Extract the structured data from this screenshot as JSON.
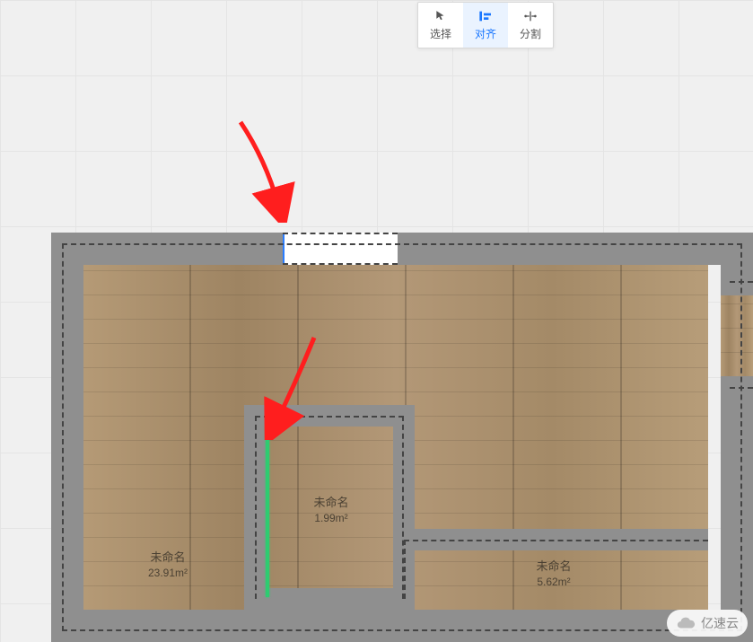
{
  "toolbar": {
    "select": {
      "label": "选择",
      "active": false
    },
    "align": {
      "label": "对齐",
      "active": true
    },
    "split": {
      "label": "分割",
      "active": false
    }
  },
  "rooms": {
    "r1": {
      "name": "未命名",
      "area": "23.91m²"
    },
    "r2": {
      "name": "未命名",
      "area": "1.99m²"
    },
    "r3": {
      "name": "未命名",
      "area": "5.62m²"
    }
  },
  "highlight": {
    "color": "#2ecc71"
  },
  "opening": {
    "edge_color": "#2a7dff"
  },
  "arrows": {
    "color": "#ff1e1e"
  },
  "watermark": {
    "text": "亿速云"
  }
}
